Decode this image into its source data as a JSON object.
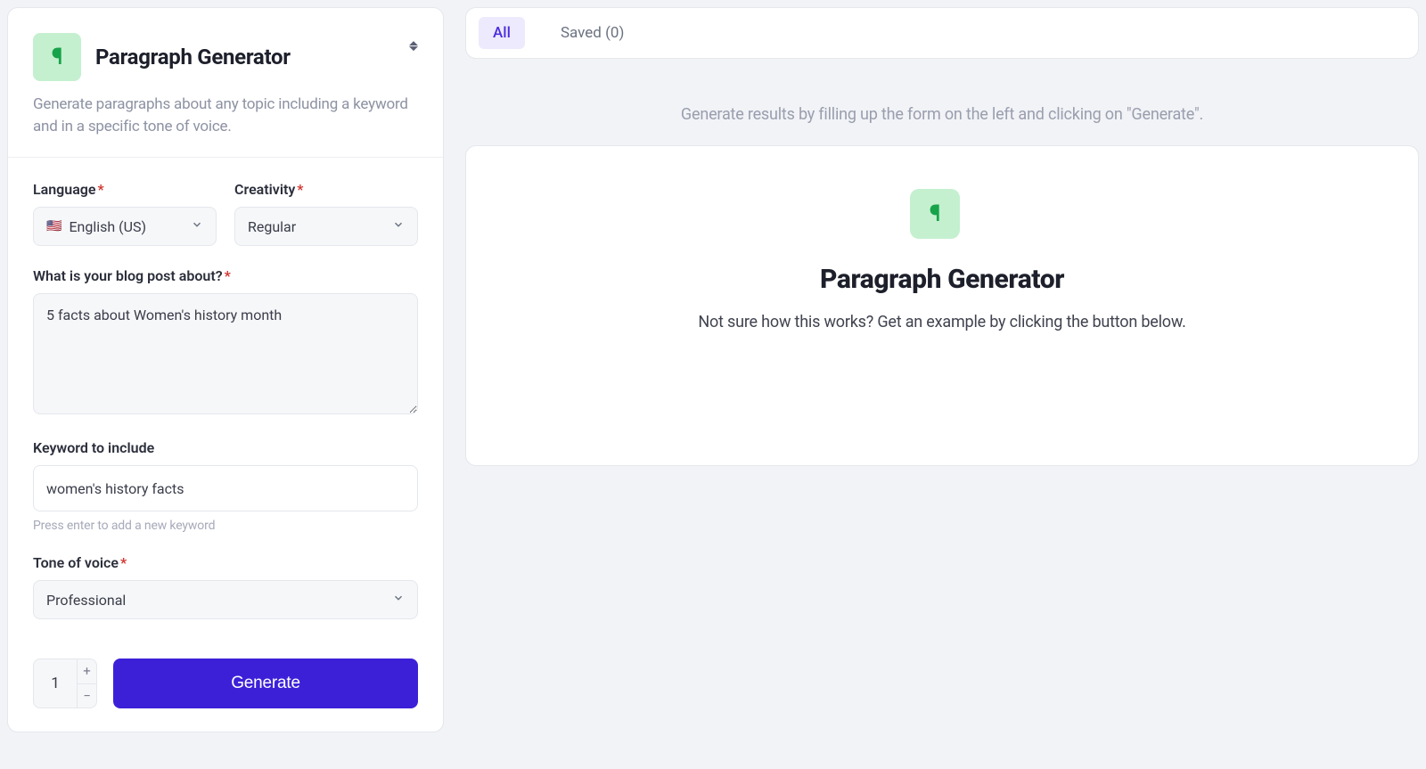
{
  "left": {
    "title": "Paragraph Generator",
    "description": "Generate paragraphs about any topic including a keyword and in a specific tone of voice.",
    "language": {
      "label": "Language",
      "value": "English (US)",
      "flag": "🇺🇸"
    },
    "creativity": {
      "label": "Creativity",
      "value": "Regular"
    },
    "topic": {
      "label": "What is your blog post about?",
      "value": "5 facts about Women's history month"
    },
    "keyword": {
      "label": "Keyword to include",
      "value": "women's history facts",
      "helper": "Press enter to add a new keyword"
    },
    "tone": {
      "label": "Tone of voice",
      "value": "Professional"
    },
    "count": "1",
    "generate_label": "Generate"
  },
  "right": {
    "tabs": {
      "all": "All",
      "saved": "Saved (0)"
    },
    "hint": "Generate results by filling up the form on the left and clicking on \"Generate\".",
    "empty": {
      "title": "Paragraph Generator",
      "sub": "Not sure how this works? Get an example by clicking the button below."
    }
  }
}
